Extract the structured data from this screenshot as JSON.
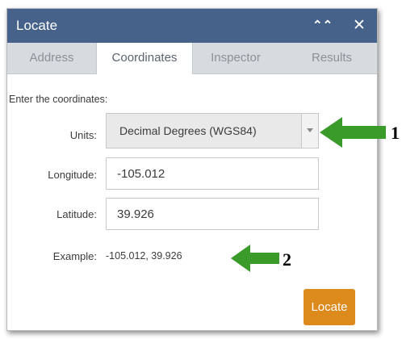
{
  "window": {
    "title": "Locate",
    "collapse_icon": "double-chevron-up-icon",
    "close_icon": "close-icon"
  },
  "tabs": [
    {
      "label": "Address",
      "active": false
    },
    {
      "label": "Coordinates",
      "active": true
    },
    {
      "label": "Inspector",
      "active": false
    },
    {
      "label": "Results",
      "active": false
    }
  ],
  "form": {
    "instruction": "Enter the coordinates:",
    "units_label": "Units:",
    "units_value": "Decimal Degrees (WGS84)",
    "longitude_label": "Longitude:",
    "longitude_value": "-105.012",
    "latitude_label": "Latitude:",
    "latitude_value": "39.926",
    "example_label": "Example:",
    "example_value": "-105.012, 39.926"
  },
  "locate_button": "Locate",
  "annotations": [
    {
      "number": "1",
      "color": "#3a9a2a"
    },
    {
      "number": "2",
      "color": "#3a9a2a"
    }
  ],
  "colors": {
    "title_bar": "#46628a",
    "tab_bar": "#d6dbe0",
    "locate_button": "#dd8a1d",
    "annotation_arrow": "#3a9a2a"
  }
}
